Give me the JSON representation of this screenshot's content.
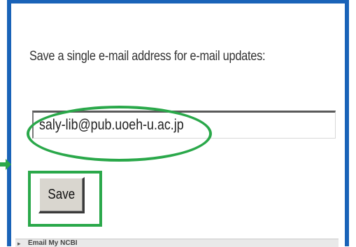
{
  "form": {
    "prompt": "Save a single e-mail address for e-mail updates:",
    "email_value": "saly-lib@pub.uoeh-u.ac.jp",
    "save_label": "Save"
  },
  "bottom_panel": {
    "label": "Email My NCBI"
  },
  "colors": {
    "frame": "#1a63b8",
    "highlight": "#2aa84a"
  }
}
